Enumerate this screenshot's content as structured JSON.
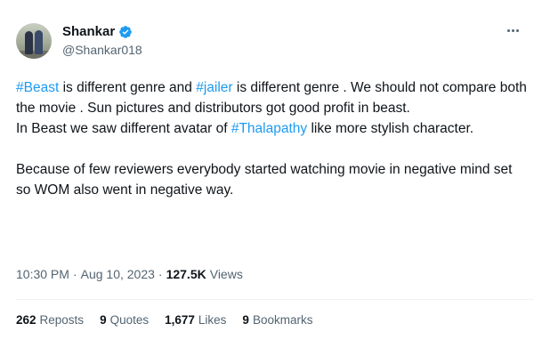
{
  "author": {
    "display_name": "Shankar",
    "handle": "@Shankar018",
    "verified_icon": "verified-badge-icon",
    "avatar_icon": "avatar-photo"
  },
  "tweet": {
    "p1": {
      "tag1": "#Beast",
      "t1": " is different genre and ",
      "tag2": "#jailer",
      "t2": " is different genre . We should not compare both the movie . Sun pictures and distributors got good profit in beast."
    },
    "p2": {
      "t1": "In Beast we saw different avatar of ",
      "tag": "#Thalapathy",
      "t2": " like more stylish character."
    },
    "p3": "Because of few reviewers everybody started watching movie in negative mind set so WOM also went in negative way."
  },
  "meta": {
    "time": "10:30 PM",
    "separator": "·",
    "date": "Aug 10, 2023",
    "views_count": "127.5K",
    "views_label": "Views"
  },
  "stats": {
    "reposts_count": "262",
    "reposts_label": "Reposts",
    "quotes_count": "9",
    "quotes_label": "Quotes",
    "likes_count": "1,677",
    "likes_label": "Likes",
    "bookmarks_count": "9",
    "bookmarks_label": "Bookmarks"
  },
  "colors": {
    "accent": "#1d9bf0",
    "text": "#0f1419",
    "muted": "#536471"
  }
}
